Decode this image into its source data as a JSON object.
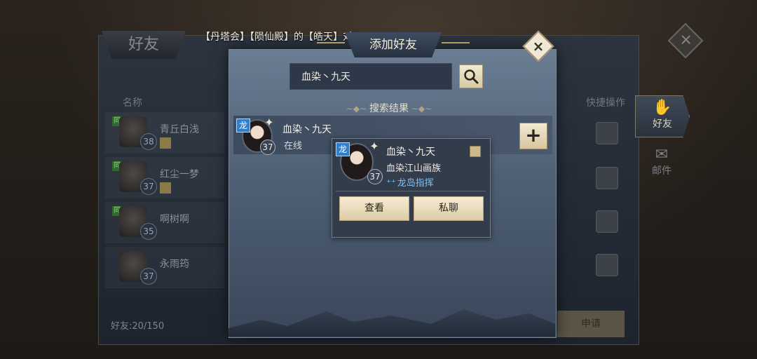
{
  "marquee": {
    "text": "【丹塔会】【陨仙殿】的【皓天】对"
  },
  "friends_panel": {
    "title": "好友",
    "col_name": "名称",
    "col_quick": "快捷操作",
    "friends": [
      {
        "name": "青丘白浅",
        "level": "38"
      },
      {
        "name": "红尘一梦",
        "level": "37"
      },
      {
        "name": "啊树啊",
        "level": "35"
      },
      {
        "name": "永雨筠",
        "level": "37"
      }
    ],
    "friend_count": "好友:20/150",
    "apply_label": "申请",
    "tabs": [
      {
        "label": "好友",
        "icon": "handshake-icon"
      },
      {
        "label": "邮件",
        "icon": "mail-icon"
      }
    ]
  },
  "dialog": {
    "title": "添加好友",
    "search_value": "血染丶九天",
    "results_header": "搜索结果",
    "result": {
      "name": "血染丶九天",
      "status": "在线",
      "level": "37",
      "faction_badge": "龙",
      "add_label": "+"
    }
  },
  "popup": {
    "name": "血染丶九天",
    "level": "37",
    "faction_badge": "龙",
    "clan": "血染江山画族",
    "role": "龙岛指挥",
    "view_label": "查看",
    "chat_label": "私聊"
  },
  "colors": {
    "dialog_bg": "#4f6075",
    "button_cream": "#f4ecd4",
    "role_blue": "#7ec3f0",
    "faction_blue": "#2f7fcb"
  }
}
